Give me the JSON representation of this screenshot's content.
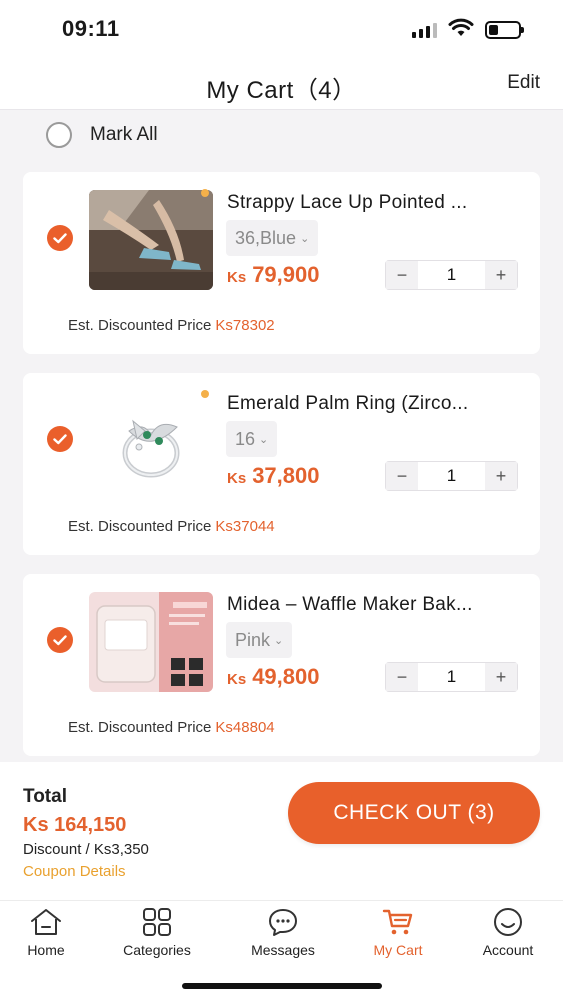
{
  "status_bar": {
    "time": "09:11"
  },
  "header": {
    "title": "My Cart（4）",
    "edit_label": "Edit"
  },
  "mark_all": {
    "label": "Mark All"
  },
  "items": [
    {
      "name": "Strappy Lace Up Pointed ...",
      "variant": "36,Blue",
      "currency": "Ks",
      "price": "79,900",
      "quantity": "1",
      "est_label": "Est. Discounted Price",
      "est_price": "Ks78302"
    },
    {
      "name": "Emerald Palm Ring (Zirco...",
      "variant": "16",
      "currency": "Ks",
      "price": "37,800",
      "quantity": "1",
      "est_label": "Est. Discounted Price",
      "est_price": "Ks37044"
    },
    {
      "name": "Midea – Waffle Maker Bak...",
      "variant": "Pink",
      "currency": "Ks",
      "price": "49,800",
      "quantity": "1",
      "est_label": "Est. Discounted Price",
      "est_price": "Ks48804"
    }
  ],
  "stepper": {
    "minus": "−",
    "plus": "+"
  },
  "summary": {
    "total_label": "Total",
    "total_amount": "Ks 164,150",
    "discount": "Discount / Ks3,350",
    "coupon_details": "Coupon Details",
    "checkout_label": "CHECK OUT (3)"
  },
  "tabs": [
    {
      "label": "Home",
      "icon": "home-icon"
    },
    {
      "label": "Categories",
      "icon": "grid-icon"
    },
    {
      "label": "Messages",
      "icon": "chat-icon"
    },
    {
      "label": "My Cart",
      "icon": "cart-icon",
      "active": true
    },
    {
      "label": "Account",
      "icon": "smiley-icon"
    }
  ],
  "colors": {
    "accent": "#e8602b",
    "price": "#e3622e",
    "coupon": "#e9a12f"
  }
}
